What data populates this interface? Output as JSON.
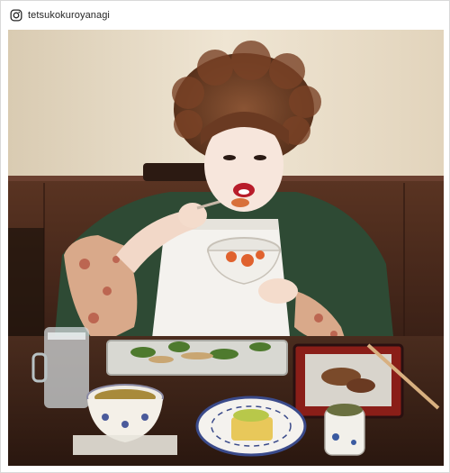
{
  "post": {
    "username": "tetsukokuroyanagi",
    "platform_icon": "instagram-icon"
  },
  "photo": {
    "subject": "woman-dining",
    "colors": {
      "wall": "#e8dcc8",
      "panel": "#4a2a1c",
      "table": "#3a2218",
      "cardigan": "#2e4a34",
      "apron": "#f4f2ee",
      "hair": "#6a3a22"
    }
  }
}
